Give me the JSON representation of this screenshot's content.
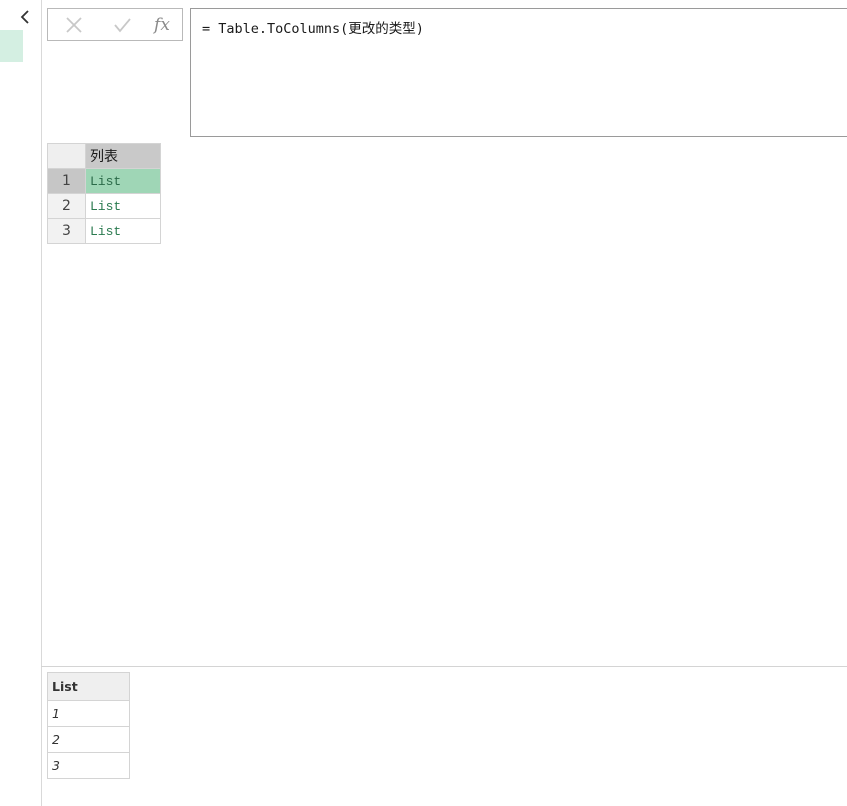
{
  "formula_bar": {
    "cancel_icon": "close-icon",
    "commit_icon": "check-icon",
    "fx_label": "fx",
    "formula": "= Table.ToColumns(更改的类型)"
  },
  "grid": {
    "column_header": "列表",
    "rows": [
      {
        "num": "1",
        "value": "List",
        "selected": true
      },
      {
        "num": "2",
        "value": "List",
        "selected": false
      },
      {
        "num": "3",
        "value": "List",
        "selected": false
      }
    ]
  },
  "preview": {
    "header": "List",
    "values": [
      "1",
      "2",
      "3"
    ]
  },
  "colors": {
    "selected_cell": "#9fd6b6",
    "list_text": "#2a7a4f",
    "query_highlight": "#d4efe2"
  }
}
